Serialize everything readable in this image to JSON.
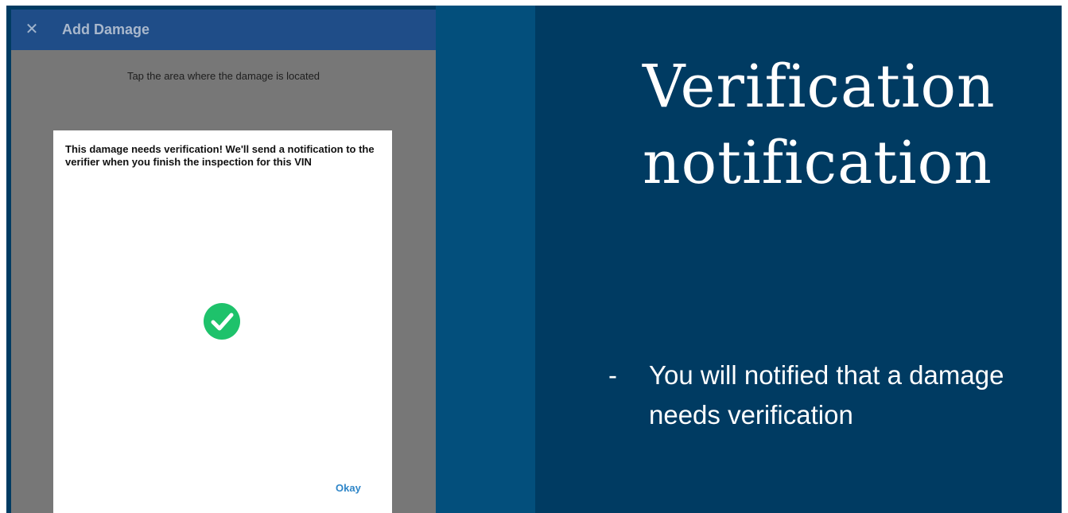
{
  "app": {
    "title": "Add Damage",
    "close_label": "✕",
    "hint": "Tap the area where the damage is located"
  },
  "dialog": {
    "message": "This damage needs verification! We'll send a notification to the verifier when you finish the inspection for this VIN",
    "icon": "check-circle-icon",
    "confirm_label": "Okay"
  },
  "slide": {
    "title_line1": "Verification",
    "title_line2": "notification",
    "bullet_marker": "-",
    "bullet_text": "You will notified that a damage needs verification"
  },
  "colors": {
    "slide_bg": "#003b62",
    "band": "#034f7c",
    "appbar": "#1f4d88",
    "overlay": "#777777",
    "success": "#1ec26b",
    "link": "#2f86c8"
  }
}
